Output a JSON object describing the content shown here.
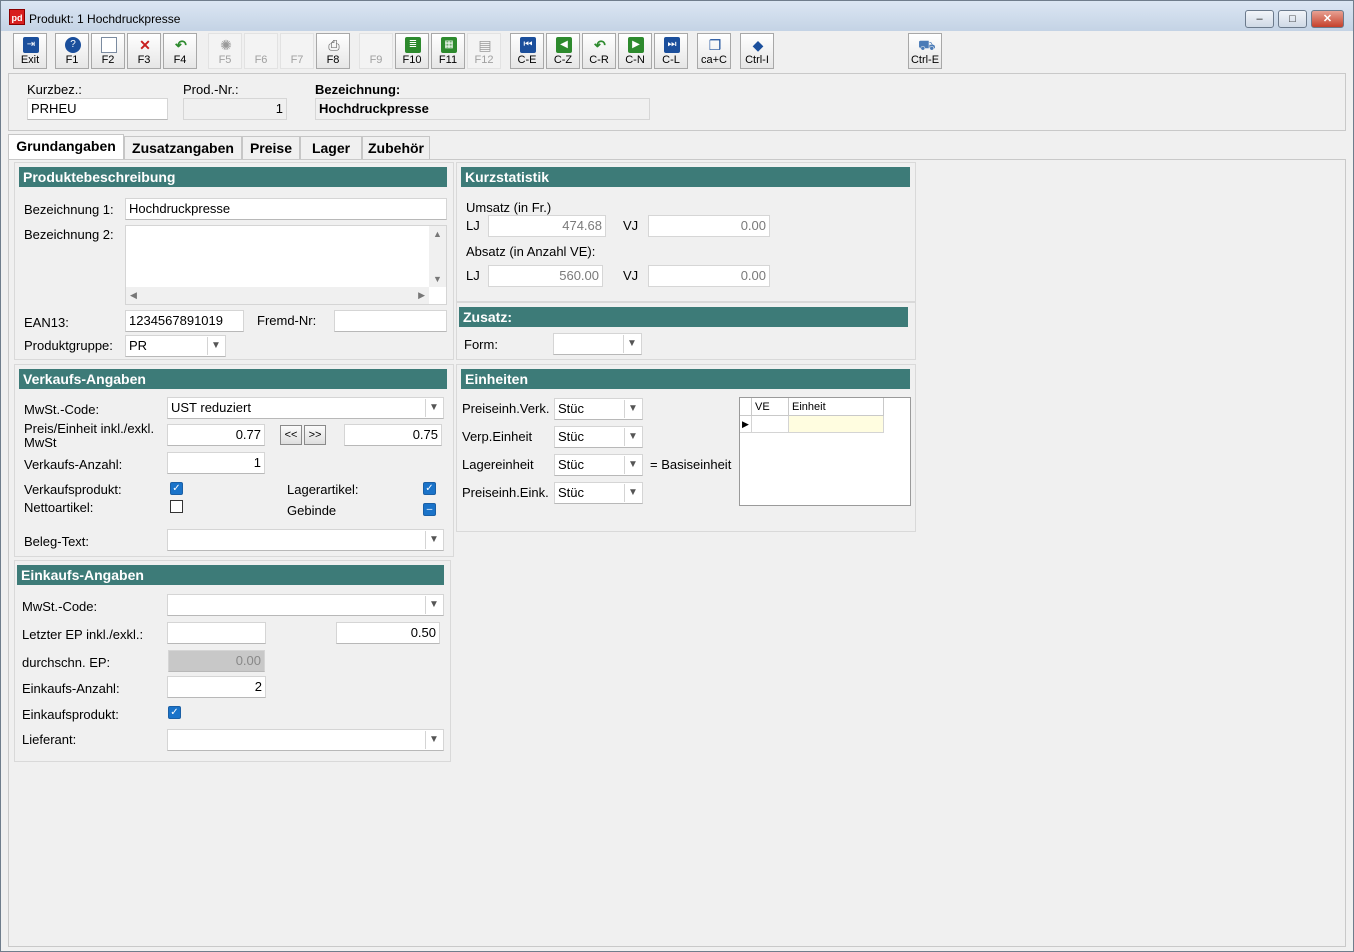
{
  "window": {
    "title": "Produkt: 1 Hochdruckpresse",
    "app_icon_text": "pd",
    "controls": {
      "minimize": "‒",
      "maximize": "□",
      "close": "✕"
    }
  },
  "toolbar": {
    "exit": "Exit",
    "f1": "F1",
    "f2": "F2",
    "f3": "F3",
    "f4": "F4",
    "f5": "F5",
    "f6": "F6",
    "f7": "F7",
    "f8": "F8",
    "f9": "F9",
    "f10": "F10",
    "f11": "F11",
    "f12": "F12",
    "ce": "C-E",
    "cz": "C-Z",
    "cr": "C-R",
    "cn": "C-N",
    "cl": "C-L",
    "cac": "ca+C",
    "ctrli": "Ctrl-I",
    "ctrle": "Ctrl-E"
  },
  "header": {
    "kurzbez_label": "Kurzbez.:",
    "kurzbez_value": "PRHEU",
    "prodnr_label": "Prod.-Nr.:",
    "prodnr_value": "1",
    "bezeichnung_label": "Bezeichnung:",
    "bezeichnung_value": "Hochdruckpresse"
  },
  "tabs": [
    "Grundangaben",
    "Zusatzangaben",
    "Preise",
    "Lager",
    "Zubehör"
  ],
  "produktbeschreibung": {
    "title": "Produktebeschreibung",
    "bez1_label": "Bezeichnung 1:",
    "bez1_value": "Hochdruckpresse",
    "bez2_label": "Bezeichnung 2:",
    "bez2_value": "",
    "ean_label": "EAN13:",
    "ean_value": "1234567891019",
    "fremd_label": "Fremd-Nr:",
    "fremd_value": "",
    "gruppe_label": "Produktgruppe:",
    "gruppe_value": "PR"
  },
  "kurzstatistik": {
    "title": "Kurzstatistik",
    "umsatz_label": "Umsatz (in Fr.)",
    "absatz_label": "Absatz (in Anzahl VE):",
    "lj": "LJ",
    "vj": "VJ",
    "umsatz_lj": "474.68",
    "umsatz_vj": "0.00",
    "absatz_lj": "560.00",
    "absatz_vj": "0.00"
  },
  "zusatz": {
    "title": "Zusatz:",
    "form_label": "Form:",
    "form_value": ""
  },
  "verkauf": {
    "title": "Verkaufs-Angaben",
    "mwst_label": "MwSt.-Code:",
    "mwst_value": "UST reduziert",
    "preis_label": "Preis/Einheit inkl./exkl. MwSt",
    "preis_inkl": "0.77",
    "preis_exkl": "0.75",
    "btn_left": "<<",
    "btn_right": ">>",
    "anzahl_label": "Verkaufs-Anzahl:",
    "anzahl_value": "1",
    "verkaufsprodukt_label": "Verkaufsprodukt:",
    "nettoartikel_label": "Nettoartikel:",
    "lagerartikel_label": "Lagerartikel:",
    "gebinde_label": "Gebinde",
    "belegtext_label": "Beleg-Text:",
    "belegtext_value": ""
  },
  "einheiten": {
    "title": "Einheiten",
    "preis_verk_label": "Preiseinh.Verk.",
    "preis_verk_value": "Stüc",
    "verp_label": "Verp.Einheit",
    "verp_value": "Stüc",
    "lager_label": "Lagereinheit",
    "lager_value": "Stüc",
    "basis_label": "= Basiseinheit",
    "preis_eink_label": "Preiseinh.Eink.",
    "preis_eink_value": "Stüc",
    "grid_headers": [
      "VE",
      "Einheit"
    ],
    "row_marker": "▶"
  },
  "einkauf": {
    "title": "Einkaufs-Angaben",
    "mwst_label": "MwSt.-Code:",
    "mwst_value": "",
    "ep_label": "Letzter EP inkl./exkl.:",
    "ep_inkl": "",
    "ep_exkl": "0.50",
    "durchschn_label": "durchschn. EP:",
    "durchschn_value": "0.00",
    "anzahl_label": "Einkaufs-Anzahl:",
    "anzahl_value": "2",
    "einkaufsprodukt_label": "Einkaufsprodukt:",
    "lieferant_label": "Lieferant:",
    "lieferant_value": ""
  }
}
